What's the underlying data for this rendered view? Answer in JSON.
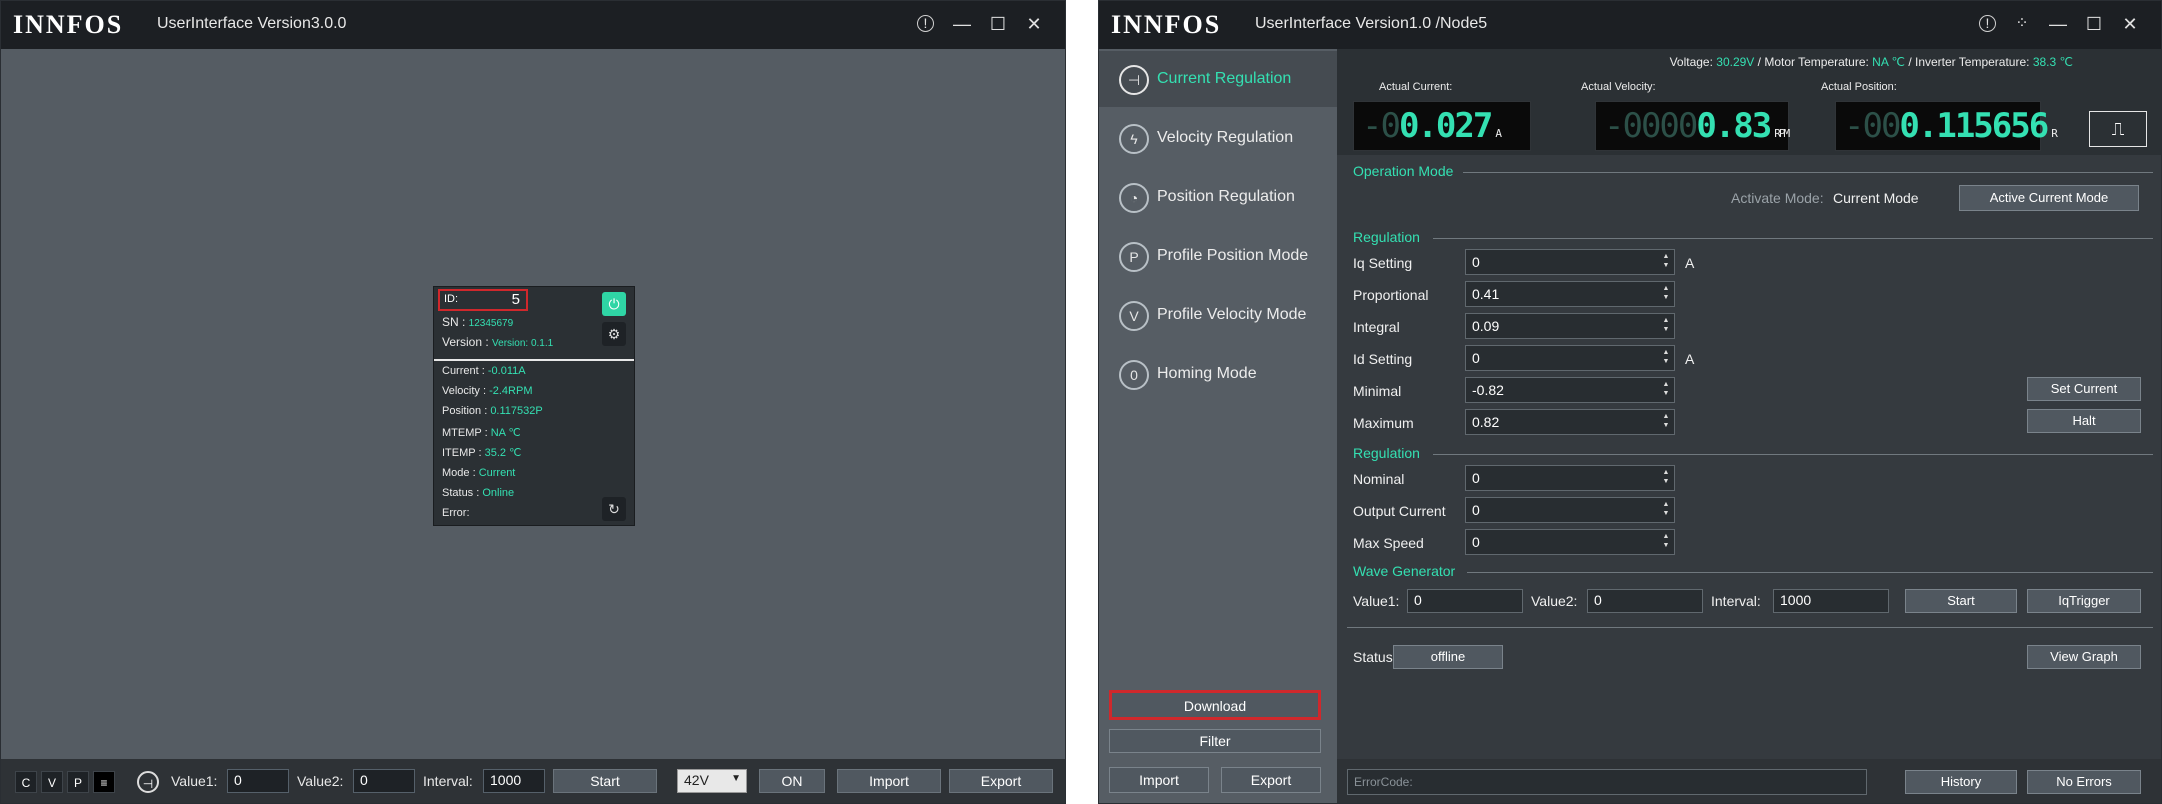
{
  "window1": {
    "logo": "INNFOS",
    "title": "UserInterface Version3.0.0",
    "controls": {
      "info": "!",
      "minimize": "—",
      "maximize": "☐",
      "close": "✕"
    },
    "card": {
      "id_label": "ID:",
      "id_value": "5",
      "sn_label": "SN : ",
      "sn_value": "12345679",
      "version_label": "Version : ",
      "version_value": "Version: 0.1.1",
      "rows": [
        {
          "label": "Current : ",
          "value": "-0.011A"
        },
        {
          "label": "Velocity : ",
          "value": "-2.4RPM"
        },
        {
          "label": "Position : ",
          "value": "0.117532P"
        },
        {
          "label": "MTEMP : ",
          "value": "NA ℃"
        },
        {
          "label": "ITEMP : ",
          "value": "35.2 ℃"
        },
        {
          "label": "Mode : ",
          "value": "Current"
        },
        {
          "label": "Status : ",
          "value": "Online"
        },
        {
          "label": "Error:",
          "value": ""
        }
      ]
    },
    "bottom": {
      "mode_buttons": [
        "C",
        "V",
        "P",
        "≡"
      ],
      "value1_label": "Value1:",
      "value1": "0",
      "value2_label": "Value2:",
      "value2": "0",
      "interval_label": "Interval:",
      "interval": "1000",
      "start": "Start",
      "voltage": "42V",
      "on": "ON",
      "import": "Import",
      "export": "Export"
    }
  },
  "window2": {
    "logo": "INNFOS",
    "title": "UserInterface Version1.0 /Node5",
    "nav": [
      {
        "label": "Current Regulation",
        "icon": "⊣"
      },
      {
        "label": "Velocity Regulation",
        "icon": "ϟ"
      },
      {
        "label": "Position Regulation",
        "icon": "◔"
      },
      {
        "label": "Profile Position Mode",
        "icon": "P"
      },
      {
        "label": "Profile Velocity Mode",
        "icon": "V"
      },
      {
        "label": "Homing Mode",
        "icon": "0"
      }
    ],
    "sidebar_buttons": {
      "download": "Download",
      "filter": "Filter",
      "import": "Import",
      "export": "Export"
    },
    "status_bar": {
      "voltage_label": "Voltage: ",
      "voltage": "30.29V",
      "motor_temp_label": " / Motor Temperature: ",
      "motor_temp": "NA ℃",
      "inverter_temp_label": " / Inverter Temperature: ",
      "inverter_temp": "38.3 ℃"
    },
    "displays": [
      {
        "label": "Actual Current:",
        "dim": "-0",
        "value": "0.027",
        "unit": "A"
      },
      {
        "label": "Actual Velocity:",
        "dim": "-0000",
        "value": "0.83",
        "unit": "RPM"
      },
      {
        "label": "Actual Position:",
        "dim": "-00",
        "value": "0.115656",
        "unit": "R"
      }
    ],
    "operation_mode": {
      "title": "Operation Mode",
      "activate_label": "Activate Mode:",
      "activate_value": " Current Mode",
      "button": "Active Current Mode"
    },
    "regulation1": {
      "title": "Regulation",
      "fields": [
        {
          "label": "Iq Setting",
          "value": "0",
          "unit": "A"
        },
        {
          "label": "Proportional",
          "value": "0.41",
          "unit": ""
        },
        {
          "label": "Integral",
          "value": "0.09",
          "unit": ""
        },
        {
          "label": "Id Setting",
          "value": "0",
          "unit": "A"
        },
        {
          "label": "Minimal",
          "value": "-0.82",
          "unit": ""
        },
        {
          "label": "Maximum",
          "value": "0.82",
          "unit": ""
        }
      ],
      "set_current": "Set Current",
      "halt": "Halt"
    },
    "regulation2": {
      "title": "Regulation",
      "fields": [
        {
          "label": "Nominal",
          "value": "0"
        },
        {
          "label": "Output Current",
          "value": "0"
        },
        {
          "label": "Max Speed",
          "value": "0"
        }
      ]
    },
    "wave": {
      "title": "Wave Generator",
      "value1_label": "Value1:",
      "value1": "0",
      "value2_label": "Value2:",
      "value2": "0",
      "interval_label": "Interval:",
      "interval": "1000",
      "start": "Start",
      "iqtrigger": "IqTrigger"
    },
    "status": {
      "label": "Status",
      "value": "offline",
      "view_graph": "View Graph"
    },
    "bottom": {
      "errorcode_placeholder": "ErrorCode:",
      "history": "History",
      "no_errors": "No Errors"
    }
  }
}
